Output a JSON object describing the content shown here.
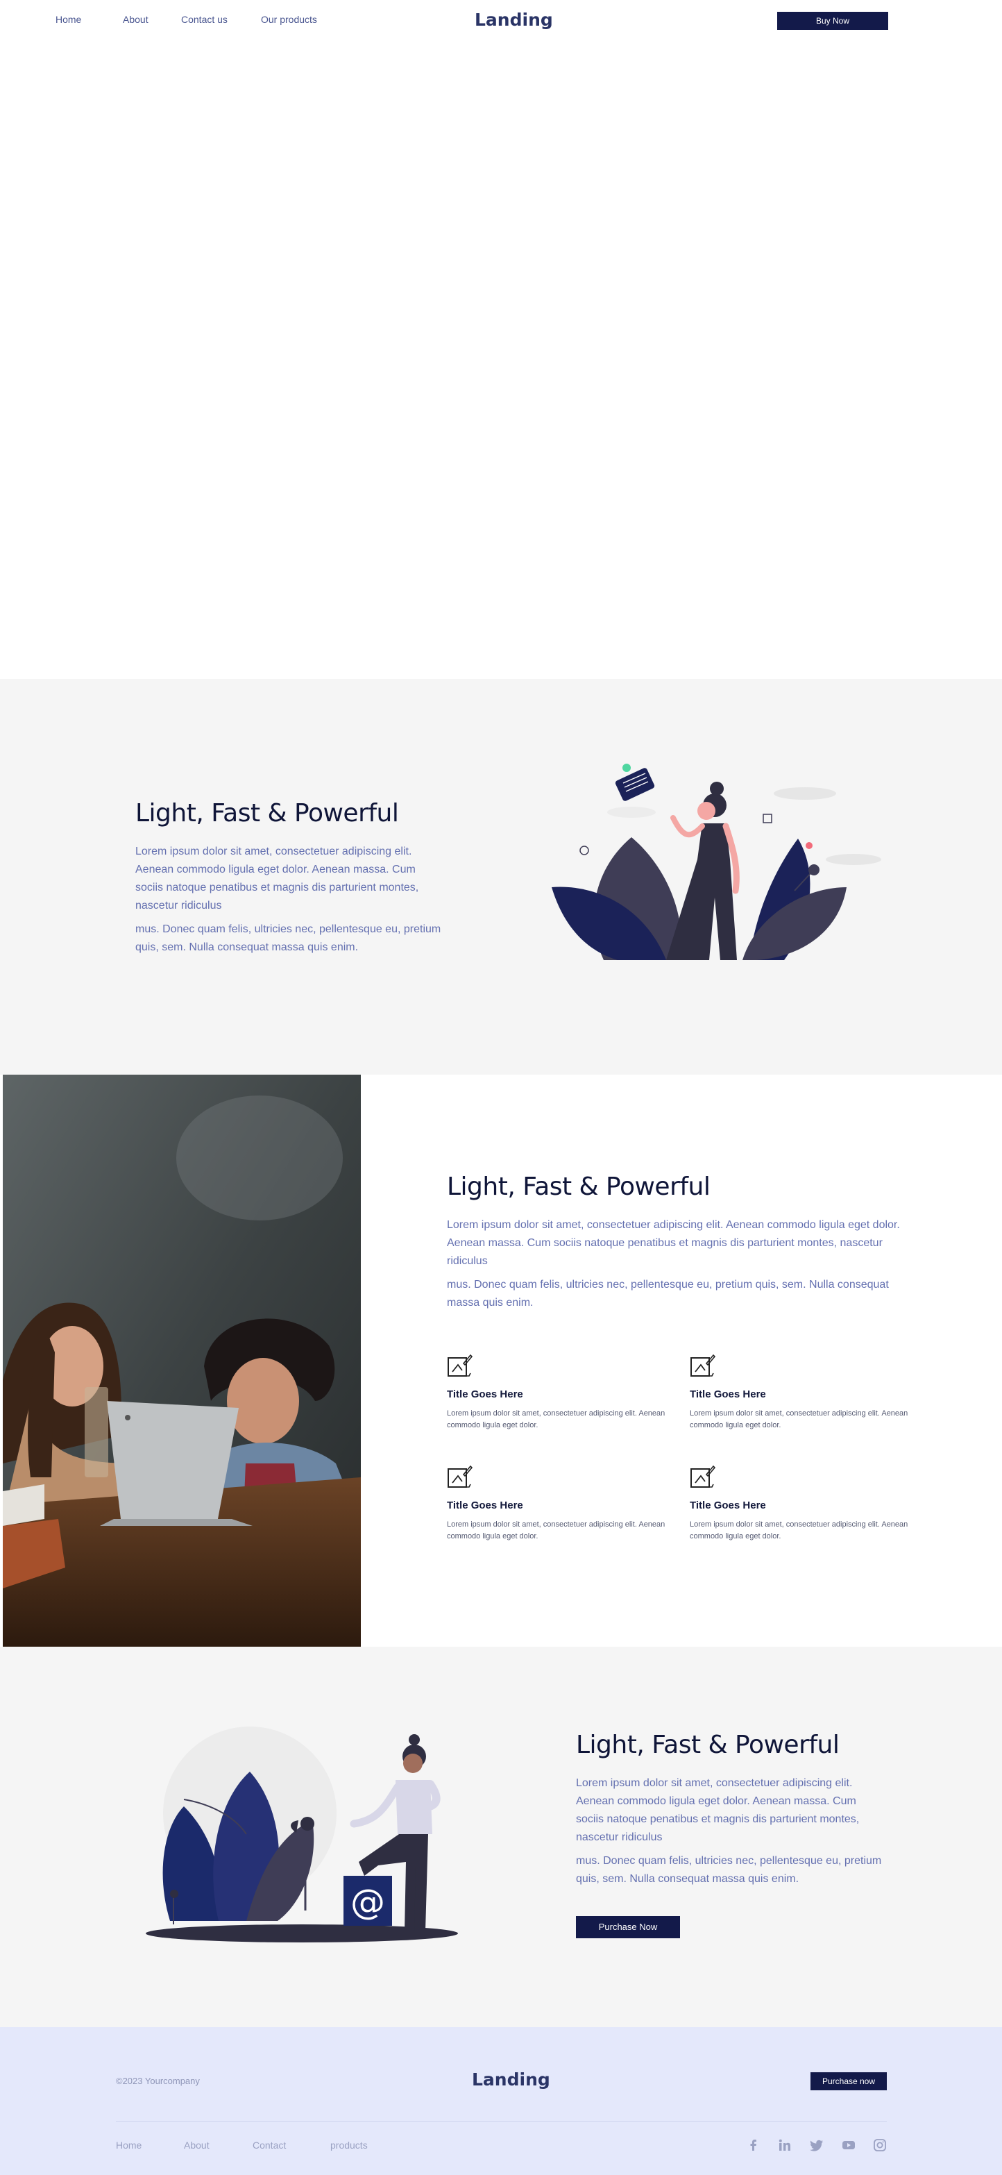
{
  "nav": {
    "links": [
      "Home",
      "About",
      "Contact us",
      "Our products"
    ],
    "brand": "Landing",
    "cta": "Buy Now"
  },
  "section1": {
    "title": "Light, Fast & Powerful",
    "para1": "Lorem ipsum dolor sit amet, consectetuer adipiscing elit. Aenean commodo ligula eget dolor. Aenean massa. Cum sociis natoque penatibus et magnis dis parturient montes, nascetur ridiculus",
    "para2": "mus. Donec quam felis, ultricies nec, pellentesque eu, pretium quis, sem. Nulla consequat massa quis enim."
  },
  "section2": {
    "title": "Light, Fast & Powerful",
    "para1": "Lorem ipsum dolor sit amet, consectetuer adipiscing elit. Aenean commodo ligula eget dolor. Aenean massa. Cum sociis natoque penatibus et magnis dis parturient montes, nascetur ridiculus",
    "para2": "mus. Donec quam felis, ultricies nec, pellentesque eu, pretium quis, sem. Nulla consequat massa quis enim.",
    "features": [
      {
        "title": "Title Goes Here",
        "text": "Lorem ipsum dolor sit amet, consectetuer adipiscing elit. Aenean commodo ligula eget dolor."
      },
      {
        "title": "Title Goes Here",
        "text": "Lorem ipsum dolor sit amet, consectetuer adipiscing elit. Aenean commodo ligula eget dolor."
      },
      {
        "title": "Title Goes Here",
        "text": "Lorem ipsum dolor sit amet, consectetuer adipiscing elit. Aenean commodo ligula eget dolor."
      },
      {
        "title": "Title Goes Here",
        "text": "Lorem ipsum dolor sit amet, consectetuer adipiscing elit. Aenean commodo ligula eget dolor."
      }
    ]
  },
  "section3": {
    "title": "Light, Fast & Powerful",
    "para1": "Lorem ipsum dolor sit amet, consectetuer adipiscing elit. Aenean commodo ligula eget dolor. Aenean massa. Cum sociis natoque penatibus et magnis dis parturient montes, nascetur ridiculus",
    "para2": "mus. Donec quam felis, ultricies nec, pellentesque eu, pretium quis, sem. Nulla consequat massa quis enim.",
    "cta": "Purchase Now"
  },
  "footer": {
    "copyright": "©2023 Yourcompany",
    "brand": "Landing",
    "cta": "Purchase now",
    "links": [
      "Home",
      "About",
      "Contact",
      "products"
    ],
    "social_icons": [
      "facebook-icon",
      "linkedin-icon",
      "twitter-icon",
      "youtube-icon",
      "instagram-icon"
    ]
  },
  "colors": {
    "navy": "#131a4a",
    "text_blue": "#6470b0",
    "section_bg": "#f5f5f5",
    "footer_bg": "#e4e8fb"
  }
}
